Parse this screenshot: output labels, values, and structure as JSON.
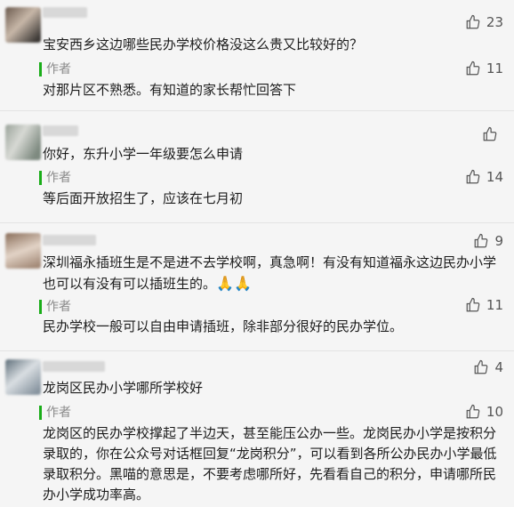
{
  "comments": [
    {
      "text": "宝安西乡这边哪些民办学校价格没这么贵又比较好的？",
      "likes": "23",
      "author_label": "作者",
      "author_likes": "11",
      "reply": "对那片区不熟悉。有知道的家长帮忙回答下"
    },
    {
      "text": "你好，东升小学一年级要怎么申请",
      "likes": "",
      "author_label": "作者",
      "author_likes": "14",
      "reply": "等后面开放招生了，应该在七月初"
    },
    {
      "text": "深圳福永插班生是不是进不去学校啊，真急啊！有没有知道福永这边民办小学也可以有没有可以插班生的。",
      "emoji": "🙏🙏",
      "likes": "9",
      "author_label": "作者",
      "author_likes": "11",
      "reply": "民办学校一般可以自由申请插班，除非部分很好的民办学位。"
    },
    {
      "text": "龙岗区民办小学哪所学校好",
      "likes": "4",
      "author_label": "作者",
      "author_likes": "10",
      "reply": "龙岗区的民办学校撑起了半边天，甚至能压公办一些。龙岗民办小学是按积分录取的，你在公众号对话框回复“龙岗积分”，可以看到各所公办民办小学最低录取积分。黑喵的意思是，不要考虑哪所好，先看看自己的积分，申请哪所民办小学成功率高。"
    }
  ],
  "colors": {
    "author_bar": "#1aad19",
    "background": "#f5f5f5"
  },
  "icons": {
    "like": "thumbs-up-icon"
  }
}
